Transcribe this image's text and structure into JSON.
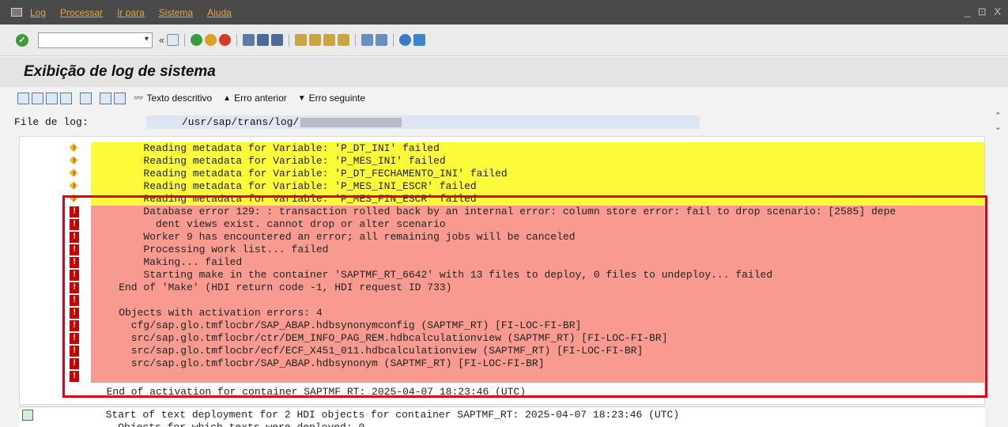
{
  "menubar": {
    "items": [
      "Log",
      "Processar",
      "Ir para",
      "Sistema",
      "Ajuda"
    ],
    "window_controls": "_ ⊡ X"
  },
  "toolbar": {
    "command_field_value": "",
    "back_glyph": "«"
  },
  "title": "Exibição de log de sistema",
  "app_toolbar": {
    "texto_descritivo": "Texto descritivo",
    "erro_anterior": "Erro anterior",
    "erro_seguinte": "Erro seguinte"
  },
  "file": {
    "label": "File de log:",
    "path": "/usr/sap/trans/log/"
  },
  "log_lines": [
    {
      "type": "warn",
      "text": "        Reading metadata for Variable: 'P_DT_INI' failed"
    },
    {
      "type": "warn",
      "text": "        Reading metadata for Variable: 'P_MES_INI' failed"
    },
    {
      "type": "warn",
      "text": "        Reading metadata for Variable: 'P_DT_FECHAMENTO_INI' failed"
    },
    {
      "type": "warn",
      "text": "        Reading metadata for Variable: 'P_MES_INI_ESCR' failed"
    },
    {
      "type": "warn",
      "text": "        Reading metadata for Variable: 'P_MES_FIN_ESCR' failed"
    },
    {
      "type": "err",
      "text": "        Database error 129: : transaction rolled back by an internal error: column store error: fail to drop scenario: [2585] depe"
    },
    {
      "type": "err",
      "text": "          dent views exist. cannot drop or alter scenario"
    },
    {
      "type": "err",
      "text": "        Worker 9 has encountered an error; all remaining jobs will be canceled"
    },
    {
      "type": "err",
      "text": "        Processing work list... failed"
    },
    {
      "type": "err",
      "text": "        Making... failed"
    },
    {
      "type": "err",
      "text": "        Starting make in the container 'SAPTMF_RT_6642' with 13 files to deploy, 0 files to undeploy... failed"
    },
    {
      "type": "err",
      "text": "    End of 'Make' (HDI return code -1, HDI request ID 733)"
    },
    {
      "type": "err",
      "text": ""
    },
    {
      "type": "err",
      "text": "    Objects with activation errors: 4"
    },
    {
      "type": "err",
      "text": "      cfg/sap.glo.tmflocbr/SAP_ABAP.hdbsynonymconfig (SAPTMF_RT) [FI-LOC-FI-BR]"
    },
    {
      "type": "err",
      "text": "      src/sap.glo.tmflocbr/ctr/DEM_INFO_PAG_REM.hdbcalculationview (SAPTMF_RT) [FI-LOC-FI-BR]"
    },
    {
      "type": "err",
      "text": "      src/sap.glo.tmflocbr/ecf/ECF_X451_011.hdbcalculationview (SAPTMF_RT) [FI-LOC-FI-BR]"
    },
    {
      "type": "err",
      "text": "      src/sap.glo.tmflocbr/SAP_ABAP.hdbsynonym (SAPTMF_RT) [FI-LOC-FI-BR]"
    },
    {
      "type": "err",
      "text": ""
    },
    {
      "type": "plain",
      "text": "  End of activation for container SAPTMF_RT: 2025-04-07 18:23:46 (UTC)"
    }
  ],
  "log_lines_2": [
    {
      "text": "  Start of text deployment for 2 HDI objects for container SAPTMF_RT: 2025-04-07 18:23:46 (UTC)"
    },
    {
      "text": "    Objects for which texts were deployed: 0"
    }
  ],
  "colors": {
    "warning_row": "#fbfb39",
    "error_row": "#f99a91",
    "highlight_frame": "#e0001a",
    "menu_text": "#f0a23a"
  }
}
